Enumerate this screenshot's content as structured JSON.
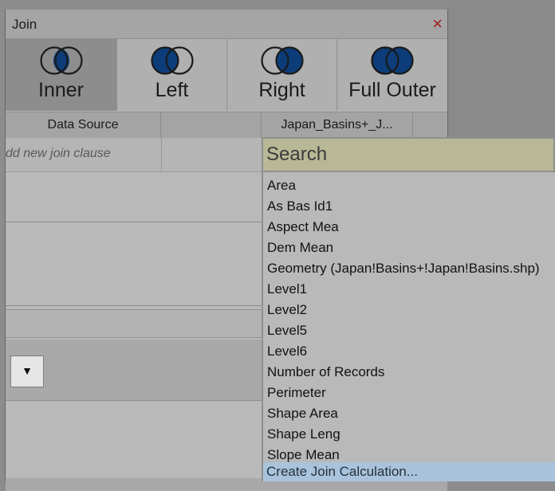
{
  "dialog": {
    "title": "Join",
    "close_symbol": "×"
  },
  "join_types": [
    {
      "label": "Inner",
      "icon": "inner-join-icon",
      "selected": true
    },
    {
      "label": "Left",
      "icon": "left-join-icon",
      "selected": false
    },
    {
      "label": "Right",
      "icon": "right-join-icon",
      "selected": false
    },
    {
      "label": "Full Outer",
      "icon": "full-outer-join-icon",
      "selected": false
    }
  ],
  "grid": {
    "left_header": "Data Source",
    "right_header": "Japan_Basins+_J...",
    "add_clause_placeholder": "dd new join clause"
  },
  "dropdown": {
    "search_placeholder": "Search",
    "fields": [
      "Area",
      "As Bas Id1",
      "Aspect Mea",
      "Dem Mean",
      "Geometry (Japan!Basins+!Japan!Basins.shp)",
      "Level1",
      "Level2",
      "Level5",
      "Level6",
      "Number of Records",
      "Perimeter",
      "Shape Area",
      "Shape Leng",
      "Slope Mean"
    ],
    "create_calc": "Create Join Calculation..."
  },
  "combo": {
    "arrow": "▼"
  },
  "colors": {
    "venn_fill": "#0c3d7a",
    "close_red": "#9b1b1b",
    "search_bg": "#b8b897",
    "highlight": "#a9c3dc"
  }
}
